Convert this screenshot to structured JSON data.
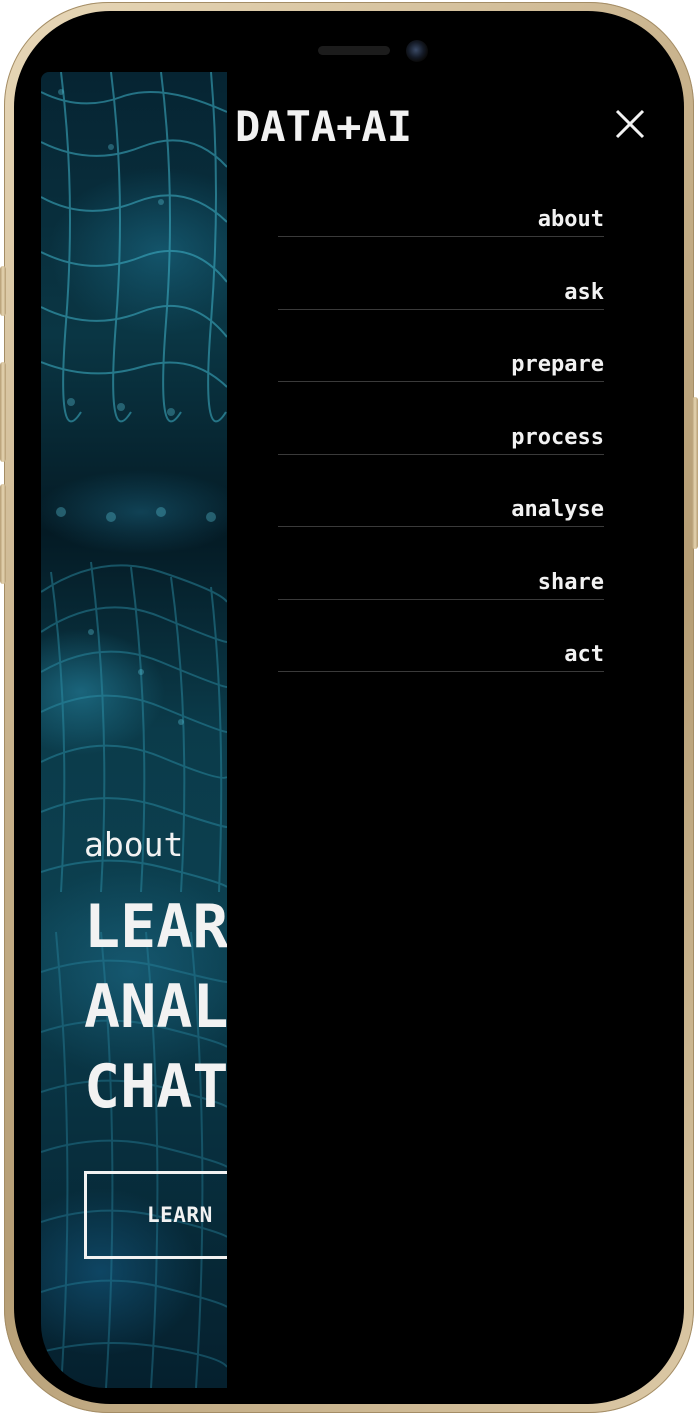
{
  "brand": "DATA+AI",
  "menu": {
    "items": [
      {
        "label": "about"
      },
      {
        "label": "ask"
      },
      {
        "label": "prepare"
      },
      {
        "label": "process"
      },
      {
        "label": "analyse"
      },
      {
        "label": "share"
      },
      {
        "label": "act"
      }
    ],
    "close_icon": "close-icon"
  },
  "hero": {
    "eyebrow": "about",
    "headline_lines": [
      "LEAR",
      "ANAL",
      "CHAT"
    ],
    "button_label": "LEARN"
  },
  "colors": {
    "background": "#000000",
    "text": "#f2f2f2",
    "divider": "#3a3a3a",
    "accent_teal": "#1e7890",
    "device_frame": "#c9b38d"
  }
}
